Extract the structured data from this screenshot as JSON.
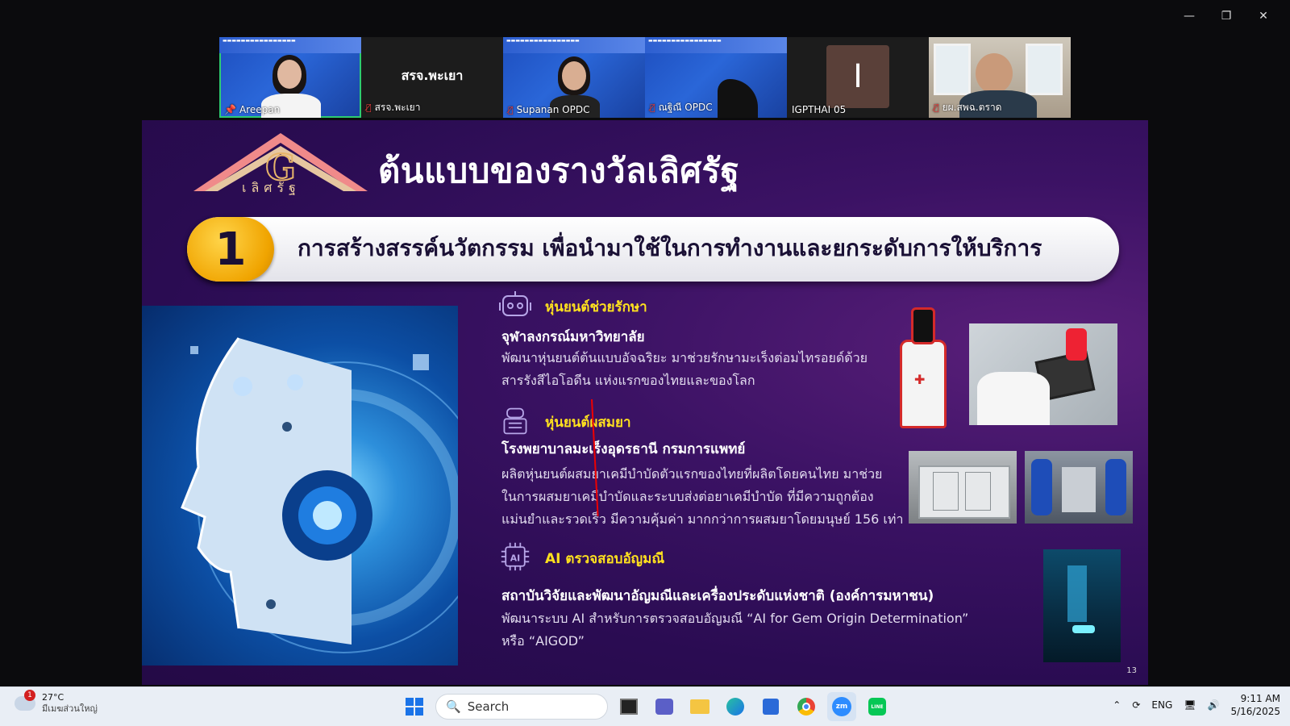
{
  "window": {
    "minimize": "—",
    "restore": "❐",
    "close": "✕"
  },
  "participants": [
    {
      "name": "Areepan",
      "pinned": true
    },
    {
      "name": "สรจ.พะเยา",
      "center_label": "สรจ.พะเยา",
      "muted": true
    },
    {
      "name": "Supanan OPDC",
      "muted": true
    },
    {
      "name": "ณฐิณี OPDC",
      "muted": true
    },
    {
      "name": "IGPTHAI 05",
      "avatar_letter": "I"
    },
    {
      "name": "ยผ.สพฉ.ตราด",
      "muted": true
    }
  ],
  "slide": {
    "logo_text": "เลิศรัฐ",
    "title": "ต้นแบบของรางวัลเลิศรัฐ",
    "number": "1",
    "banner": "การสร้างสรรค์นวัตกรรม เพื่อนำมาใช้ในการทำงานและยกระดับการให้บริการ",
    "sections": [
      {
        "icon": "robot-icon",
        "title": "หุ่นยนต์ช่วยรักษา",
        "org": "จุฬาลงกรณ์มหาวิทยาลัย",
        "desc": [
          "พัฒนาหุ่นยนต์ต้นแบบอัจฉริยะ มาช่วยรักษามะเร็งต่อมไทรอยด์ด้วย",
          "สารรังสีไอโอดีน แห่งแรกของไทยและของโลก"
        ]
      },
      {
        "icon": "robot-arm-icon",
        "title": "หุ่นยนต์ผสมยา",
        "org": "โรงพยาบาลมะเร็งอุดรธานี กรมการแพทย์",
        "desc": [
          "ผลิตหุ่นยนต์ผสมยาเคมีบำบัดตัวแรกของไทยที่ผลิตโดยคนไทย มาช่วย",
          "ในการผสมยาเคมีบำบัดและระบบส่งต่อยาเคมีบำบัด ที่มีความถูกต้อง",
          "แม่นยำและรวดเร็ว มีความคุ้มค่า มากกว่าการผสมยาโดยมนุษย์ 156 เท่า"
        ]
      },
      {
        "icon": "ai-chip-icon",
        "title": "AI ตรวจสอบอัญมณี",
        "org": "สถาบันวิจัยและพัฒนาอัญมณีและเครื่องประดับแห่งชาติ (องค์การมหาชน)",
        "desc": [
          "พัฒนาระบบ AI สำหรับการตรวจสอบอัญมณี  “AI for Gem Origin Determination”",
          "หรือ “AIGOD”"
        ]
      }
    ],
    "page": "13"
  },
  "taskbar": {
    "weather_badge": "1",
    "temp": "27°C",
    "weather_desc": "มีเมฆส่วนใหญ่",
    "search_placeholder": "Search",
    "lang": "ENG",
    "time": "9:11 AM",
    "date": "5/16/2025"
  }
}
